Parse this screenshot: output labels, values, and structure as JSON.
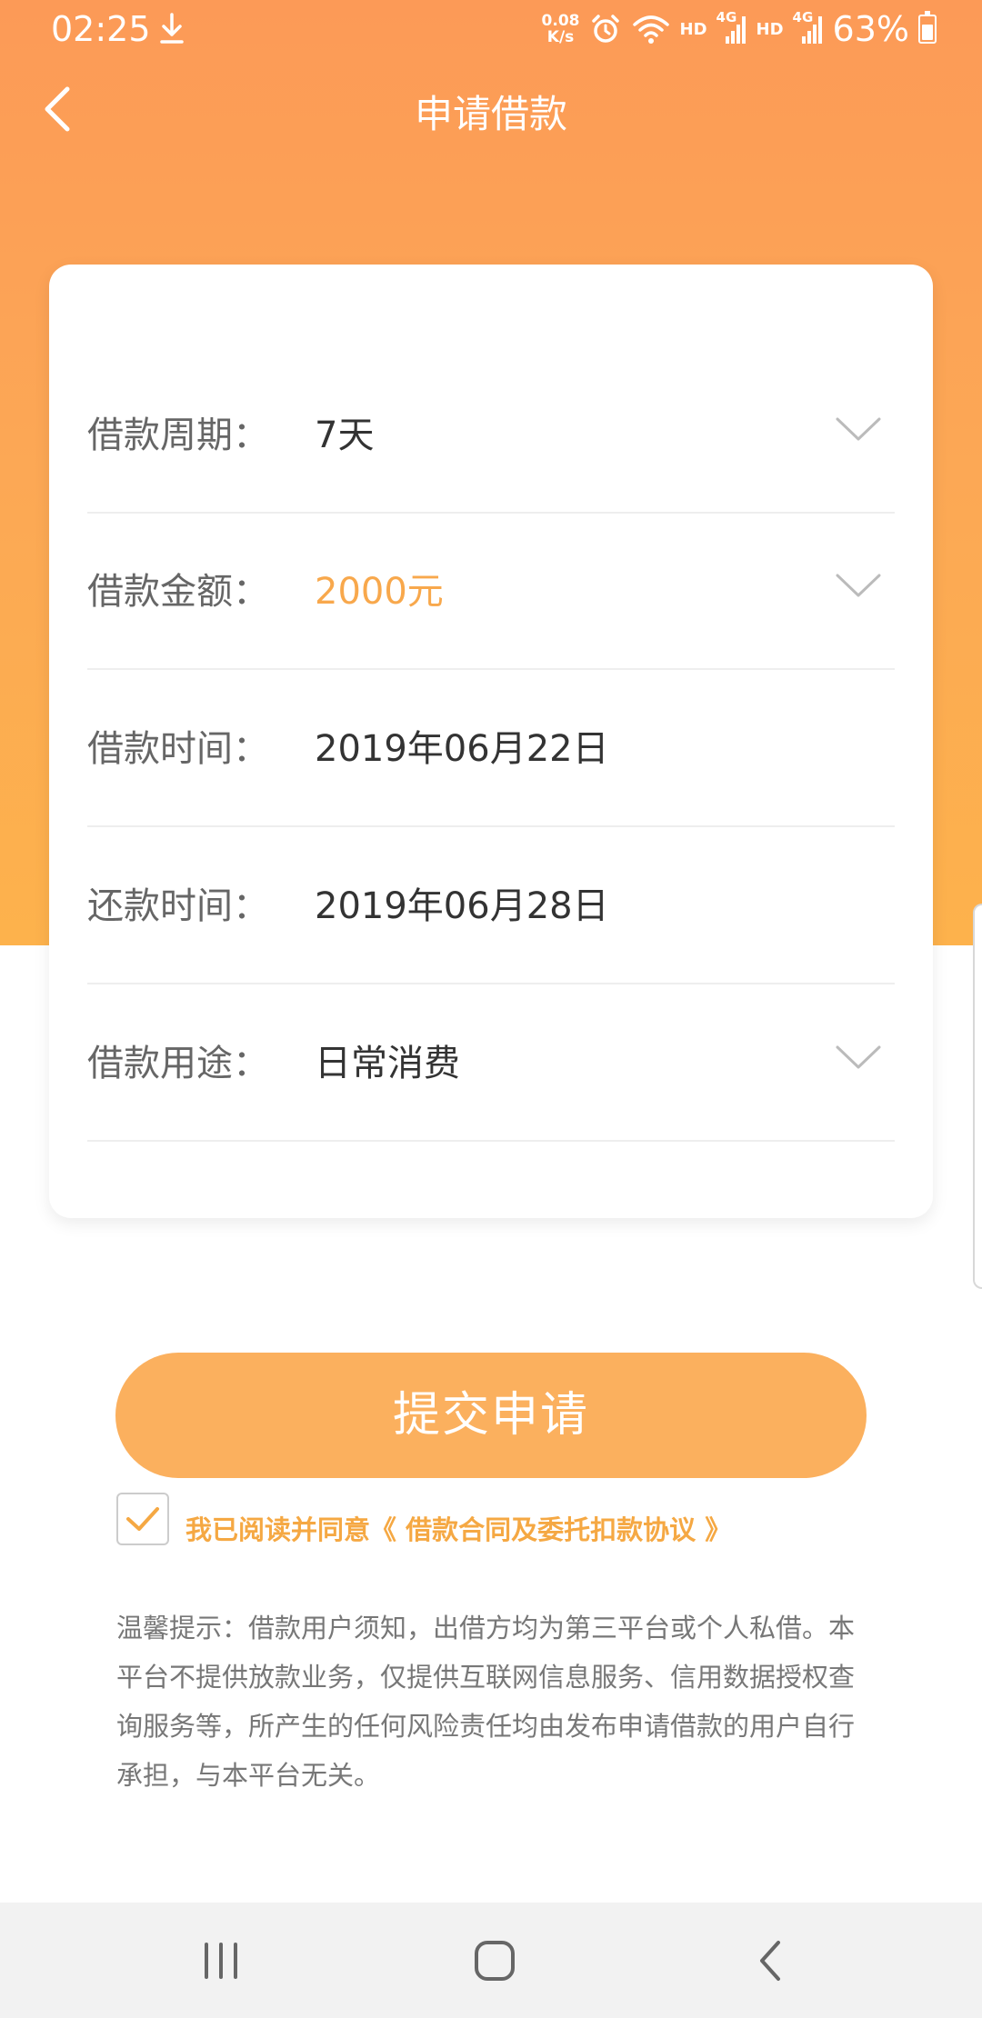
{
  "status_bar": {
    "time": "02:25",
    "net_speed_value": "0.08",
    "net_speed_unit": "K/s",
    "hd1": "HD",
    "hd2": "HD",
    "network1": "4G",
    "network2": "4G",
    "battery": "63%",
    "icons": [
      "download-icon",
      "alarm-icon",
      "wifi-icon",
      "signal-icon",
      "signal-icon",
      "battery-icon"
    ]
  },
  "header": {
    "title": "申请借款",
    "back_icon": "chevron-left-icon"
  },
  "form": {
    "rows": [
      {
        "label": "借款周期：",
        "value": "7天",
        "has_dropdown": true
      },
      {
        "label": "借款金额：",
        "value": "2000元",
        "has_dropdown": true,
        "value_color": "#f8a84c"
      },
      {
        "label": "借款时间：",
        "value": "2019年06月22日",
        "has_dropdown": false
      },
      {
        "label": "还款时间：",
        "value": "2019年06月28日",
        "has_dropdown": false
      },
      {
        "label": "借款用途：",
        "value": "日常消费",
        "has_dropdown": true
      }
    ]
  },
  "submit": {
    "label": "提交申请"
  },
  "agreement": {
    "checked": true,
    "text": "我已阅读并同意《 借款合同及委托扣款协议 》"
  },
  "tips": {
    "text": "温馨提示：借款用户须知，出借方均为第三平台或个人私借。本平台不提供放款业务，仅提供互联网信息服务、信用数据授权查询服务等，所产生的任何风险责任均由发布申请借款的用户自行承担，与本平台无关。"
  },
  "colors": {
    "header_gradient_top": "#fc9a57",
    "header_gradient_bottom": "#fdb24c",
    "accent": "#f8a84c",
    "button": "#fbb05e"
  }
}
